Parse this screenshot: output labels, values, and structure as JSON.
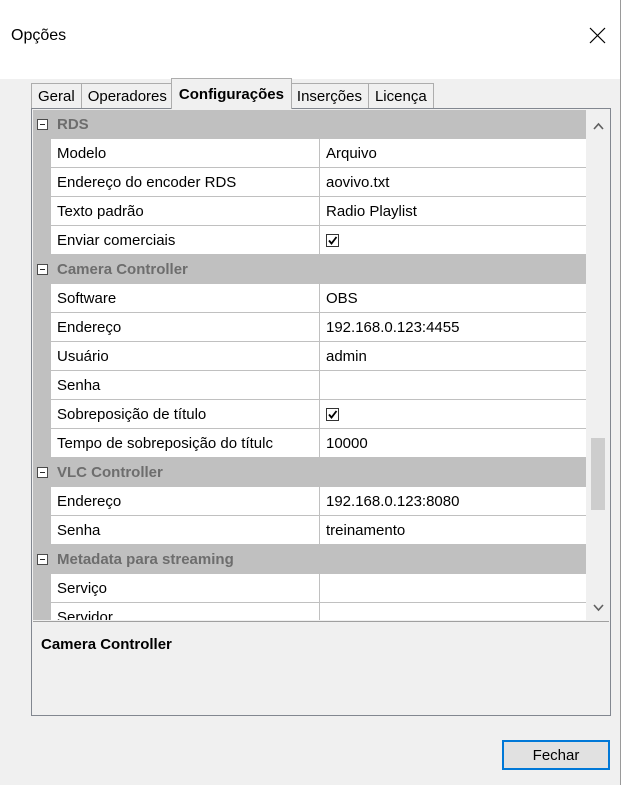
{
  "window": {
    "title": "Opções",
    "close_label": "close"
  },
  "tabs": [
    {
      "label": "Geral",
      "active": false
    },
    {
      "label": "Operadores",
      "active": false
    },
    {
      "label": "Configurações",
      "active": true
    },
    {
      "label": "Inserções",
      "active": false
    },
    {
      "label": "Licença",
      "active": false
    }
  ],
  "grid": {
    "rows": [
      {
        "kind": "category",
        "label": "RDS"
      },
      {
        "kind": "prop",
        "name": "Modelo",
        "value": "Arquivo"
      },
      {
        "kind": "prop",
        "name": "Endereço do encoder RDS",
        "value": "aovivo.txt"
      },
      {
        "kind": "prop",
        "name": "Texto padrão",
        "value": "Radio Playlist"
      },
      {
        "kind": "prop",
        "name": "Enviar comerciais",
        "value": "",
        "checkbox": true
      },
      {
        "kind": "category",
        "label": "Camera Controller"
      },
      {
        "kind": "prop",
        "name": "Software",
        "value": "OBS"
      },
      {
        "kind": "prop",
        "name": "Endereço",
        "value": "192.168.0.123:4455"
      },
      {
        "kind": "prop",
        "name": "Usuário",
        "value": "admin"
      },
      {
        "kind": "prop",
        "name": "Senha",
        "value": ""
      },
      {
        "kind": "prop",
        "name": "Sobreposição de título",
        "value": "",
        "checkbox": true
      },
      {
        "kind": "prop",
        "name": "Tempo de sobreposição do títulc",
        "value": "10000"
      },
      {
        "kind": "category",
        "label": "VLC Controller"
      },
      {
        "kind": "prop",
        "name": "Endereço",
        "value": "192.168.0.123:8080"
      },
      {
        "kind": "prop",
        "name": "Senha",
        "value": "treinamento"
      },
      {
        "kind": "category",
        "label": "Metadata para streaming"
      },
      {
        "kind": "prop",
        "name": "Serviço",
        "value": ""
      },
      {
        "kind": "prop",
        "name": "Servidor",
        "value": ""
      }
    ]
  },
  "description": {
    "title": "Camera Controller"
  },
  "buttons": {
    "close_label": "Fechar"
  }
}
